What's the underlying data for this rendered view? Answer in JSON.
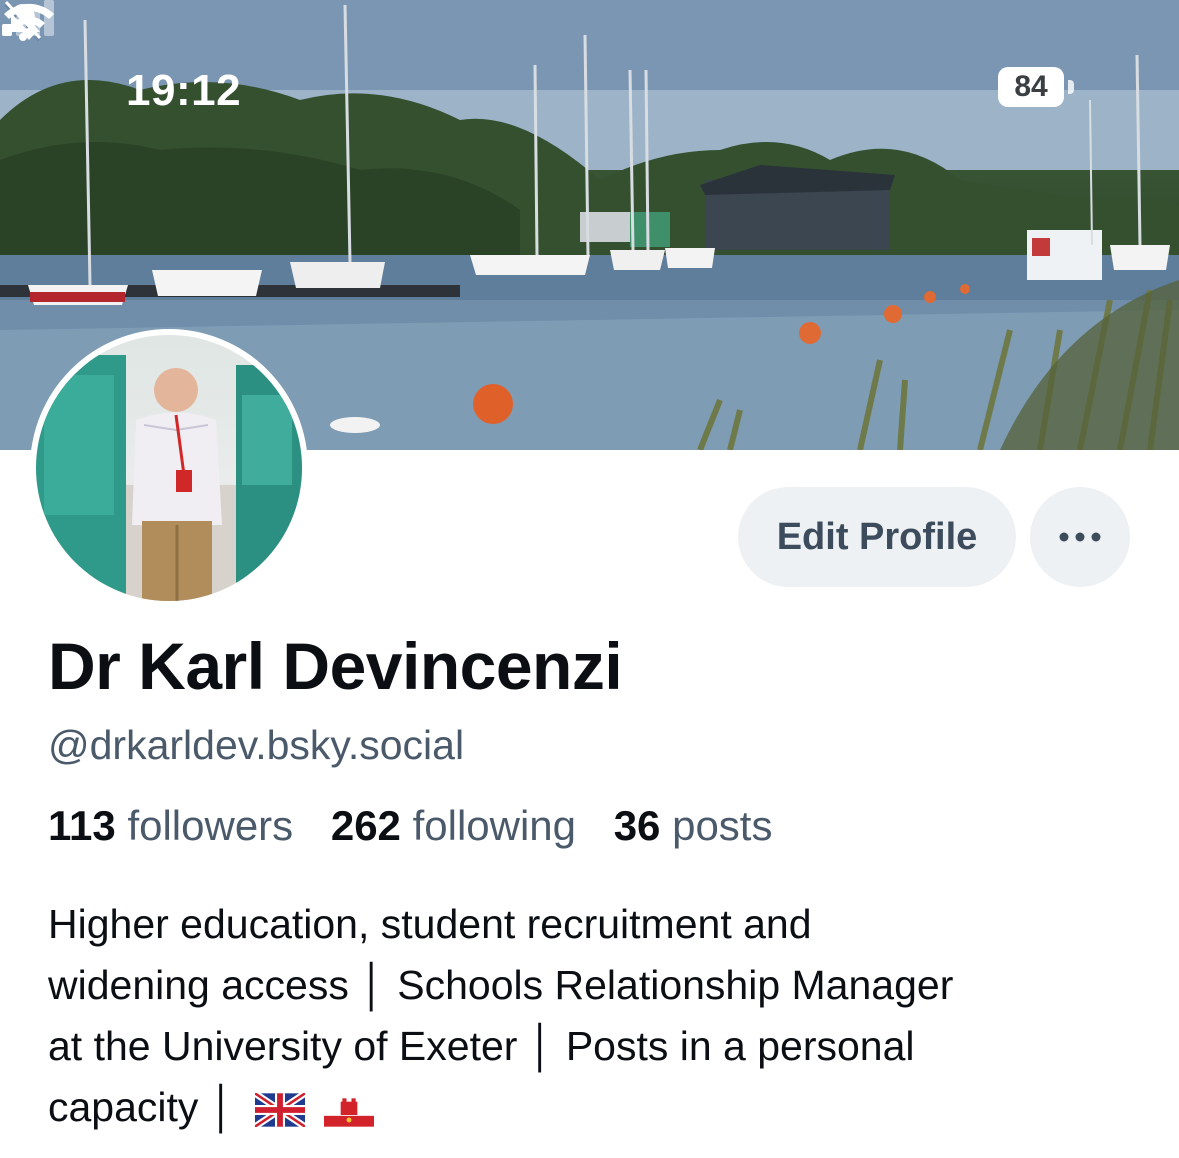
{
  "status_bar": {
    "time": "19:12",
    "battery": "84",
    "icons": [
      "bell-slash-icon",
      "cellular-signal-icon",
      "wifi-icon",
      "battery-icon"
    ]
  },
  "profile": {
    "display_name": "Dr Karl Devincenzi",
    "handle": "@drkarldev.bsky.social",
    "followers_count": "113",
    "followers_label": "followers",
    "following_count": "262",
    "following_label": "following",
    "posts_count": "36",
    "posts_label": "posts",
    "bio_lines": [
      "Higher education, student recruitment and",
      "widening access │ Schools Relationship Manager",
      "at the University of Exeter │ Posts in a personal",
      "capacity │"
    ],
    "bio_flags": [
      "uk-flag-icon",
      "gibraltar-flag-icon"
    ]
  },
  "actions": {
    "edit_profile": "Edit Profile",
    "more_icon": "ellipsis-icon"
  },
  "colors": {
    "button_bg": "#eef1f4",
    "secondary_text": "#4b5a6b",
    "primary_text": "#0b0f14"
  }
}
